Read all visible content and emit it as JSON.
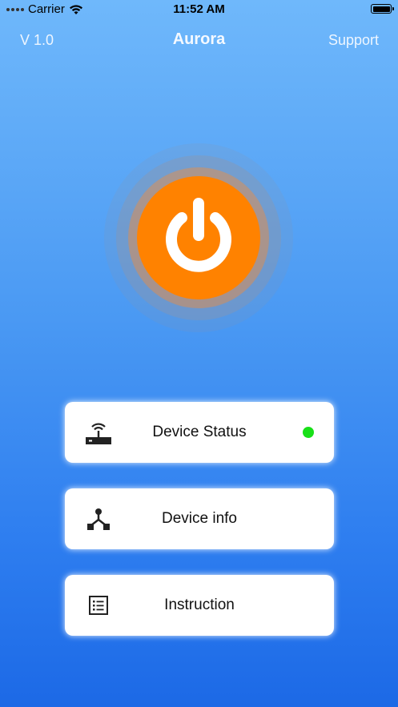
{
  "statusbar": {
    "carrier": "Carrier",
    "time": "11:52 AM"
  },
  "navbar": {
    "version": "V 1.0",
    "title": "Aurora",
    "support": "Support"
  },
  "power": {
    "icon": "power-icon",
    "color": "#ff8200"
  },
  "cards": [
    {
      "label": "Device Status",
      "icon": "router-icon",
      "status_color": "#18e018"
    },
    {
      "label": "Device info",
      "icon": "network-node-icon"
    },
    {
      "label": "Instruction",
      "icon": "list-icon"
    }
  ]
}
